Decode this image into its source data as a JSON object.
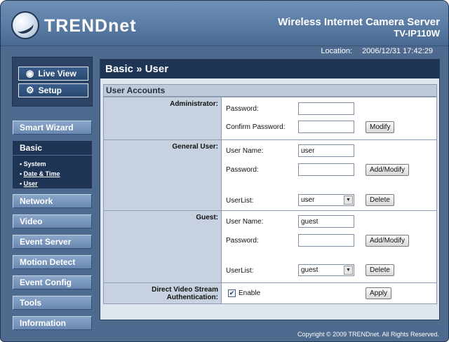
{
  "brand": {
    "logo_text": "TRENDnet"
  },
  "header": {
    "product_title": "Wireless Internet Camera Server",
    "product_model": "TV-IP110W",
    "location_label": "Location:",
    "location_datetime": "2006/12/31 17:42:29"
  },
  "sidebar": {
    "top_buttons": [
      {
        "label": "Live View",
        "icon": "eye-icon"
      },
      {
        "label": "Setup",
        "icon": "gear-icon"
      }
    ],
    "nav": [
      {
        "label": "Smart Wizard"
      },
      {
        "label": "Basic"
      },
      {
        "label": "Network"
      },
      {
        "label": "Video"
      },
      {
        "label": "Event Server"
      },
      {
        "label": "Motion Detect"
      },
      {
        "label": "Event Config"
      },
      {
        "label": "Tools"
      },
      {
        "label": "Information"
      }
    ],
    "basic_sub": [
      {
        "label": "System"
      },
      {
        "label": "Date & Time"
      },
      {
        "label": "User"
      }
    ]
  },
  "main": {
    "page_title": "Basic » User",
    "section_title": "User Accounts",
    "administrator": {
      "label": "Administrator:",
      "password_label": "Password:",
      "confirm_label": "Confirm Password:",
      "password_value": "",
      "confirm_value": "",
      "modify_button": "Modify"
    },
    "general_user": {
      "label": "General User:",
      "username_label": "User Name:",
      "username_value": "user",
      "password_label": "Password:",
      "password_value": "",
      "add_modify_button": "Add/Modify",
      "userlist_label": "UserList:",
      "userlist_selected": "user",
      "delete_button": "Delete"
    },
    "guest": {
      "label": "Guest:",
      "username_label": "User Name:",
      "username_value": "guest",
      "password_label": "Password:",
      "password_value": "",
      "add_modify_button": "Add/Modify",
      "userlist_label": "UserList:",
      "userlist_selected": "guest",
      "delete_button": "Delete"
    },
    "stream_auth": {
      "label": "Direct Video Stream Authentication:",
      "enable_label": "Enable",
      "enabled": true,
      "apply_button": "Apply"
    }
  },
  "footer": {
    "copyright": "Copyright © 2009 TRENDnet. All Rights Reserved."
  }
}
